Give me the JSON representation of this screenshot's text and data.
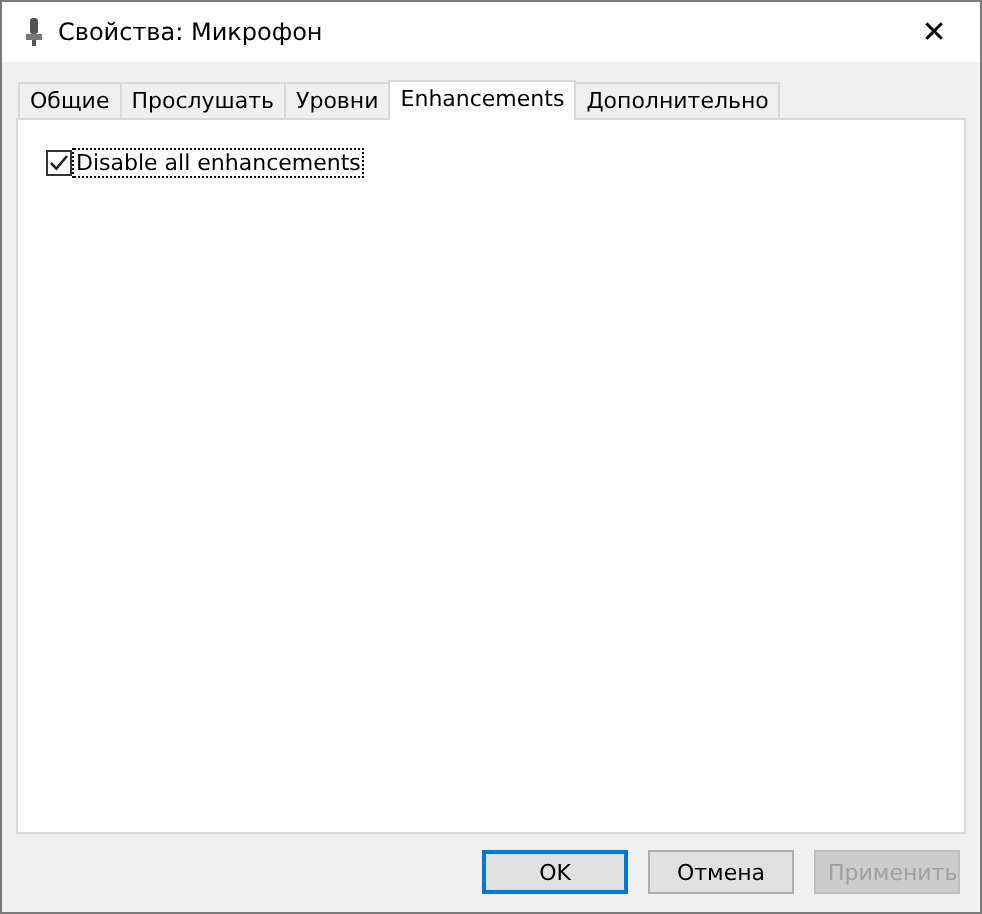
{
  "window": {
    "title": "Свойства: Микрофон",
    "close": "✕"
  },
  "tabs": [
    {
      "label": "Общие",
      "selected": false
    },
    {
      "label": "Прослушать",
      "selected": false
    },
    {
      "label": "Уровни",
      "selected": false
    },
    {
      "label": "Enhancements",
      "selected": true
    },
    {
      "label": "Дополнительно",
      "selected": false
    }
  ],
  "options": [
    {
      "label": "Disable all enhancements",
      "checked": true,
      "focused": true
    }
  ],
  "buttons": [
    {
      "label": "OK",
      "default": true,
      "disabled": false
    },
    {
      "label": "Отмена",
      "default": false,
      "disabled": false
    },
    {
      "label": "Применить",
      "default": false,
      "disabled": true
    }
  ]
}
